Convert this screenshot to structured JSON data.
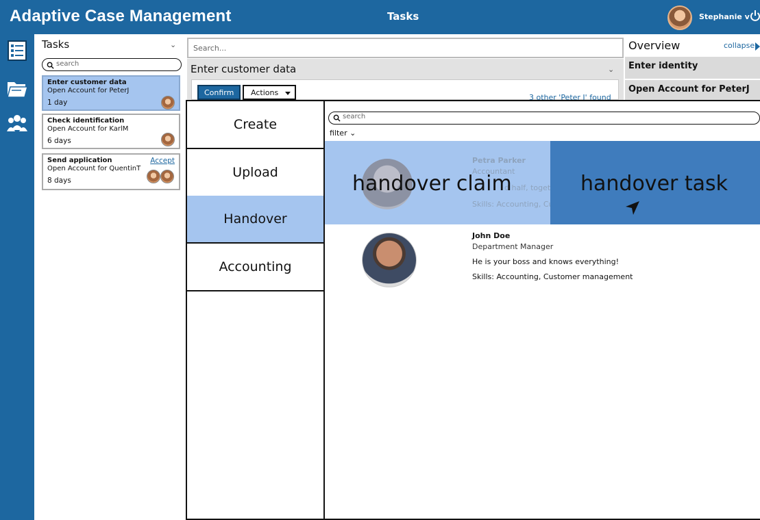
{
  "header": {
    "app_title": "Adaptive Case Management",
    "center_tab": "Tasks",
    "user_name": "Stephanie v"
  },
  "tasks": {
    "heading": "Tasks",
    "search_placeholder": "search",
    "items": [
      {
        "title": "Enter customer data",
        "subtitle": "Open Account for PeterJ",
        "age": "1 day"
      },
      {
        "title": "Check identification",
        "subtitle": "Open Account for KarlM",
        "age": "6 days"
      },
      {
        "title": "Send application",
        "subtitle": "Open Account for QuentinT",
        "age": "8 days",
        "action": "Accept"
      }
    ]
  },
  "main": {
    "search_placeholder": "Search...",
    "form_title": "Enter customer data",
    "confirm_label": "Confirm",
    "actions_label": "Actions",
    "others_found": "3 other 'Peter J' found"
  },
  "overview": {
    "title": "Overview",
    "collapse": "collapse",
    "items": [
      "Enter identity",
      "Open Account for PeterJ"
    ]
  },
  "action_menu": {
    "items": [
      "Create",
      "Upload",
      "Handover",
      "Accounting"
    ],
    "selected": "Handover"
  },
  "people": {
    "search_placeholder": "search",
    "filter_label": "filter",
    "persons": [
      {
        "name": "Petra Parker",
        "role": "Accountant",
        "desc_fragment_left": "d half, together you",
        "skills": "Skills: Accounting, Customer management"
      },
      {
        "name": "John Doe",
        "role": "Department Manager",
        "desc": "He is your boss and knows everything!",
        "skills": "Skills: Accounting, Customer management"
      }
    ],
    "overlay_left": "handover claim",
    "overlay_right": "handover task"
  },
  "colors": {
    "brand_blue": "#1d67a0",
    "selection_blue": "#a5c5ef",
    "drop_target_blue": "#3f7cbd"
  },
  "icons": [
    "power-icon",
    "task-list-icon",
    "folder-icon",
    "people-icon",
    "search-icon",
    "chevron-down-icon",
    "cursor-arrow-icon"
  ]
}
